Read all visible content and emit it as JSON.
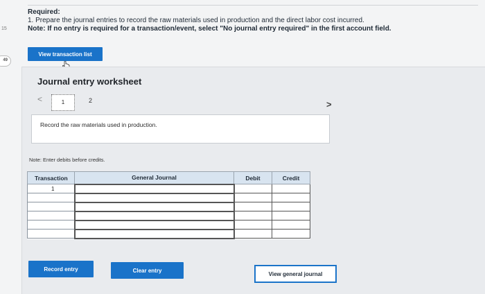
{
  "margin": {
    "num_top": "15",
    "badge": "49"
  },
  "instructions": {
    "heading": "Required:",
    "line1": "1. Prepare the journal entries to record the raw materials used in production and the direct labor cost incurred.",
    "note": "Note: If no entry is required for a transaction/event, select \"No journal entry required\" in the first account field."
  },
  "buttons": {
    "view_transaction_list": "View transaction list",
    "record_entry": "Record entry",
    "clear_entry": "Clear entry",
    "view_general_journal": "View general journal"
  },
  "worksheet": {
    "title": "Journal entry worksheet",
    "prev": "<",
    "next": ">",
    "current_page": "1",
    "next_page": "2",
    "description": "Record the raw materials used in production.",
    "note": "Note: Enter debits before credits."
  },
  "journal": {
    "headers": [
      "Transaction",
      "General Journal",
      "Debit",
      "Credit"
    ],
    "rows": [
      {
        "transaction": "1",
        "account": "",
        "debit": "",
        "credit": ""
      },
      {
        "transaction": "",
        "account": "",
        "debit": "",
        "credit": ""
      },
      {
        "transaction": "",
        "account": "",
        "debit": "",
        "credit": ""
      },
      {
        "transaction": "",
        "account": "",
        "debit": "",
        "credit": ""
      },
      {
        "transaction": "",
        "account": "",
        "debit": "",
        "credit": ""
      },
      {
        "transaction": "",
        "account": "",
        "debit": "",
        "credit": ""
      }
    ]
  },
  "colors": {
    "accent": "#1a73c9",
    "header_bg": "#d8e4f0",
    "panel_bg": "#e9ebee"
  }
}
